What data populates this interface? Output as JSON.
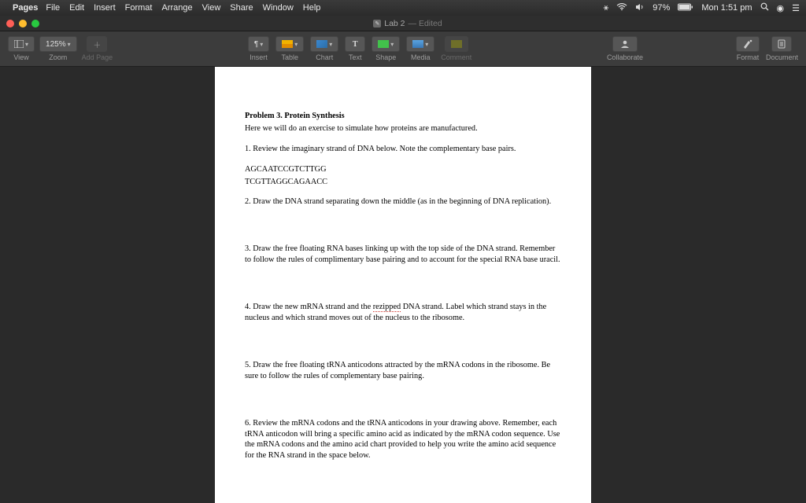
{
  "menubar": {
    "app": "Pages",
    "items": [
      "File",
      "Edit",
      "Insert",
      "Format",
      "Arrange",
      "View",
      "Share",
      "Window",
      "Help"
    ],
    "status": {
      "battery": "97%",
      "clock": "Mon 1:51 pm"
    }
  },
  "window": {
    "doc_title": "Lab 2",
    "edited": "— Edited"
  },
  "toolbar": {
    "view_label": "View",
    "zoom_value": "125%",
    "zoom_label": "Zoom",
    "add_page_label": "Add Page",
    "center": {
      "insert": "Insert",
      "table": "Table",
      "chart": "Chart",
      "text": "Text",
      "shape": "Shape",
      "media": "Media",
      "comment": "Comment"
    },
    "collaborate": "Collaborate",
    "format": "Format",
    "document": "Document"
  },
  "document": {
    "title": "Problem 3. Protein Synthesis",
    "intro": "Here we will do an exercise to simulate how proteins are manufactured.",
    "step1": "1. Review the imaginary strand of DNA below. Note the complementary base pairs.",
    "dna1": "AGCAATCCGTCTTGG",
    "dna2": "TCGTTAGGCAGAACC",
    "step2": "2. Draw the DNA strand separating down the middle (as in the beginning of DNA replication).",
    "step3": "3. Draw the free floating RNA bases linking up with the top side of the DNA strand. Remember to follow the rules of complimentary base pairing and to account for the special RNA base uracil.",
    "step4a": "4. Draw the new mRNA strand and the ",
    "step4word": "rezipped",
    "step4b": " DNA strand. Label which strand stays in the nucleus and which strand moves out of the nucleus to the ribosome.",
    "step5": "5. Draw the free floating tRNA anticodons attracted by the mRNA codons in the ribosome.  Be sure to follow the rules of complementary base pairing.",
    "step6": "6. Review the mRNA codons and the tRNA anticodons in your drawing above. Remember, each tRNA anticodon will bring a specific amino acid as indicated by the mRNA codon sequence. Use the mRNA codons and the amino acid chart provided to help you write the amino acid sequence for the RNA strand in the space below."
  }
}
